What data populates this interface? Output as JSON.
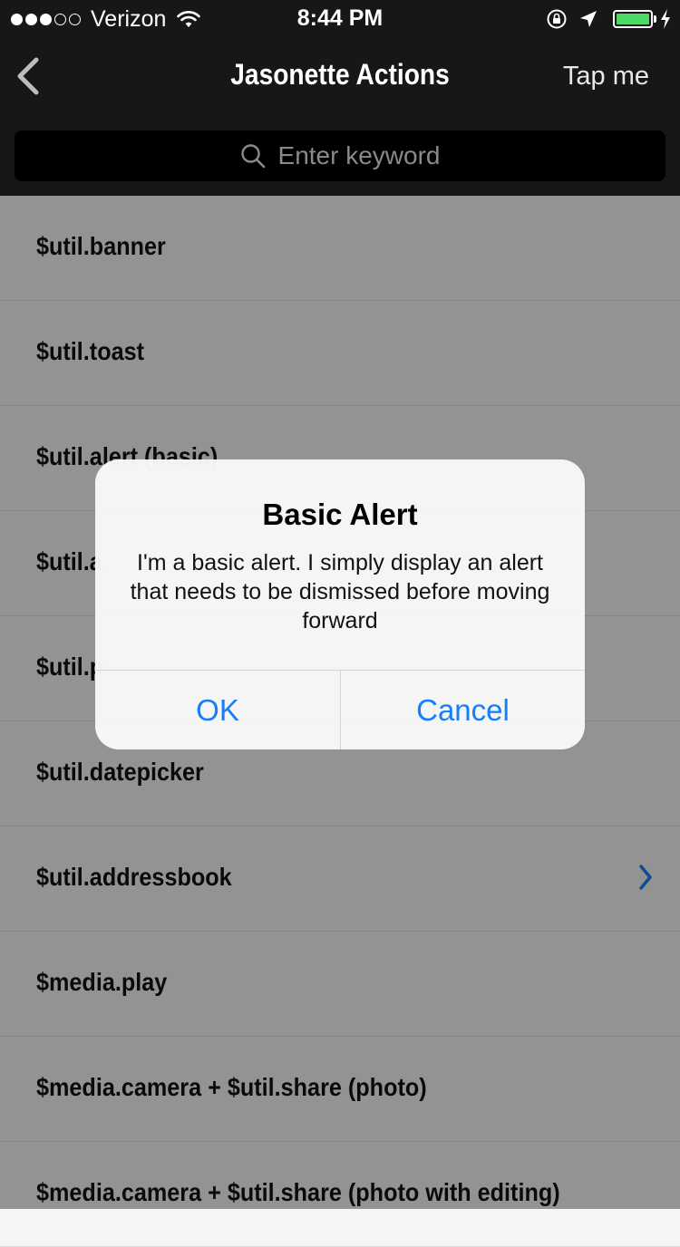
{
  "status_bar": {
    "signal_filled": 3,
    "signal_total": 5,
    "carrier": "Verizon",
    "time": "8:44 PM",
    "battery_level": 1.0,
    "battery_color": "#4cd964"
  },
  "nav": {
    "title": "Jasonette Actions",
    "right_action": "Tap me",
    "back_icon": "chevron-left-icon"
  },
  "search": {
    "placeholder": "Enter keyword",
    "icon": "search-icon"
  },
  "list": {
    "items": [
      {
        "label": "$util.banner",
        "chevron": false
      },
      {
        "label": "$util.toast",
        "chevron": false
      },
      {
        "label": "$util.alert (basic)",
        "chevron": false
      },
      {
        "label": "$util.a",
        "chevron": false
      },
      {
        "label": "$util.p",
        "chevron": false
      },
      {
        "label": "$util.datepicker",
        "chevron": false
      },
      {
        "label": "$util.addressbook",
        "chevron": true
      },
      {
        "label": "$media.play",
        "chevron": false
      },
      {
        "label": "$media.camera + $util.share (photo)",
        "chevron": false
      },
      {
        "label": "$media.camera + $util.share (photo with editing)",
        "chevron": false
      }
    ]
  },
  "alert": {
    "title": "Basic Alert",
    "message": "I'm a basic alert. I simply display an alert that needs to be dismissed before moving forward",
    "ok_label": "OK",
    "cancel_label": "Cancel",
    "button_color": "#147efb"
  },
  "colors": {
    "header_bg": "#171717",
    "list_bg": "#f5f5f5",
    "accent": "#147efb"
  }
}
